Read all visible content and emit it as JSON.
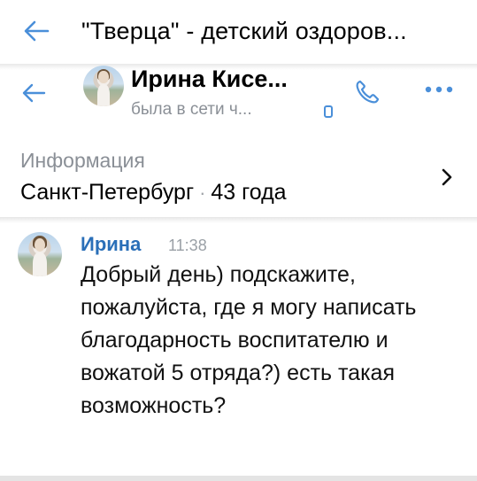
{
  "topbar": {
    "title": "\"Тверца\" - детский оздоров..."
  },
  "chat_header": {
    "name": "Ирина Кисе...",
    "status": "была в сети ч...",
    "icons": [
      "back-arrow-icon",
      "phone-icon",
      "more-icon",
      "mobile-device-icon"
    ]
  },
  "info": {
    "label": "Информация",
    "city": "Санкт-Петербург",
    "separator": "·",
    "age": "43 года"
  },
  "message": {
    "author": "Ирина",
    "time": "11:38",
    "text": "Добрый день) подскажите, пожалуйста, где я могу написать благодарность воспитателю и вожатой 5 отряда?) есть такая возможность?"
  },
  "colors": {
    "accent": "#4a8fd9",
    "author": "#2a6fb8",
    "secondary_text": "#8a8f96"
  }
}
